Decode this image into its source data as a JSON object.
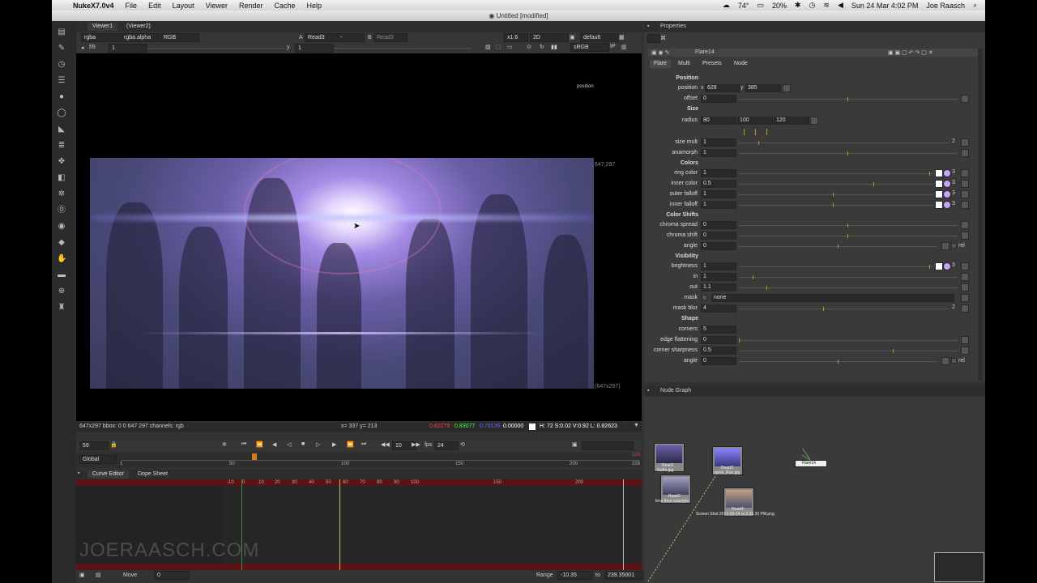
{
  "menubar": {
    "app": "NukeX7.0v4",
    "items": [
      "File",
      "Edit",
      "Layout",
      "Viewer",
      "Render",
      "Cache",
      "Help"
    ],
    "status": {
      "temperature": "74°",
      "battery": "20%",
      "datetime": "Sun 24 Mar  4:02 PM",
      "user": "Joe Raasch"
    }
  },
  "window": {
    "title": "Untitled [modified]"
  },
  "viewer": {
    "tabs": [
      "Viewer1",
      "(Viewer2)"
    ],
    "channels": "rgba",
    "alpha": "rgba.alpha",
    "colorspace_dd": "RGB",
    "a_label": "A",
    "a_input": "Read3",
    "a_op": "-",
    "b_label": "B",
    "b_input": "Read3",
    "zoom": "x1.6",
    "mode": "2D",
    "lut": "default",
    "fstop_label": "f/8",
    "fstop_value": "1",
    "y_label": "y",
    "y_value": "1",
    "srgb": "sRGB",
    "ip": "IP",
    "overlay_label": "position",
    "size_top": "647,297",
    "size_bottom": "(647x297)",
    "info_left": "647x297 bbox: 0 0 647 297 channels: rgb",
    "info_xy": "x= 337 y= 213",
    "info_r": "0.82279",
    "info_g": "0.83077",
    "info_b": "0.79136",
    "info_a": "0.00000",
    "info_hsv": "H: 72 S:0.02 V:0.92  L: 0.82623"
  },
  "timeline": {
    "frame": "59",
    "step": "10",
    "fps_label": "fps",
    "fps": "24",
    "global": "Global",
    "ticks": [
      "1",
      "50",
      "100",
      "150",
      "200",
      "228"
    ],
    "end_frame": "228"
  },
  "curve_editor": {
    "tabs": [
      "Curve Editor",
      "Dope Sheet"
    ],
    "ticks": [
      "-10",
      "0",
      "10",
      "20",
      "30",
      "40",
      "50",
      "60",
      "70",
      "80",
      "90",
      "100",
      "150",
      "200"
    ],
    "move_label": "Move",
    "move_value": "0",
    "range_label": "Range",
    "range_from": "-10.35",
    "range_to_label": "to",
    "range_to": "239.35001"
  },
  "watermark": "JOERAASCH.COM",
  "properties": {
    "header": "Properties",
    "node_name": "Flare14",
    "tabs": [
      "Flare",
      "Multi",
      "Presets",
      "Node"
    ],
    "sections": {
      "position": "Position",
      "size": "Size",
      "colors": "Colors",
      "color_shifts": "Color Shifts",
      "visibility": "Visibility",
      "shape": "Shape"
    },
    "position": {
      "label": "position",
      "x_label": "x",
      "x": "628",
      "y_label": "y",
      "y": "385"
    },
    "offset": {
      "label": "offset",
      "value": "0"
    },
    "radius": {
      "label": "radius",
      "v1": "80",
      "v2": "100",
      "v3": "120"
    },
    "size_mult": {
      "label": "size mult",
      "value": "1",
      "count": "2"
    },
    "anamorph": {
      "label": "anamorph",
      "value": "1"
    },
    "ring_color": {
      "label": "ring color",
      "value": "1",
      "count": "3"
    },
    "inner_color": {
      "label": "inner color",
      "value": "0.5",
      "count": "3"
    },
    "outer_falloff": {
      "label": "outer falloff",
      "value": "1",
      "count": "3"
    },
    "inner_falloff": {
      "label": "inner falloff",
      "value": "1",
      "count": "3"
    },
    "chroma_spread": {
      "label": "chroma spread",
      "value": "0"
    },
    "chroma_shift": {
      "label": "chroma shift",
      "value": "0"
    },
    "angle1": {
      "label": "angle",
      "value": "0",
      "rel": "rel"
    },
    "brightness": {
      "label": "brightness",
      "value": "1",
      "count": "3"
    },
    "in": {
      "label": "in",
      "value": "1"
    },
    "out": {
      "label": "out",
      "value": "1.1"
    },
    "mask": {
      "label": "mask",
      "value": "none"
    },
    "mask_blur": {
      "label": "mask blur",
      "value": "4",
      "count": "2"
    },
    "corners": {
      "label": "corners",
      "value": "5"
    },
    "edge_flattening": {
      "label": "edge flattening",
      "value": "0"
    },
    "corner_sharpness": {
      "label": "corner sharpness",
      "value": "0.5"
    },
    "angle2": {
      "label": "angle",
      "value": "0",
      "rel": "rel"
    }
  },
  "nodegraph": {
    "header": "Node Graph",
    "nodes": [
      {
        "name": "Read1",
        "file": "NoBk.jpg"
      },
      {
        "name": "Read3",
        "file": "opmk_Run.jpg"
      },
      {
        "name": "Read2",
        "file": "lens-flare-example"
      },
      {
        "name": "Read4",
        "file": "Screen Shot 2013-03-24 at 2.39.30 PM.png"
      },
      {
        "name": "Flare14",
        "file": ""
      }
    ]
  }
}
